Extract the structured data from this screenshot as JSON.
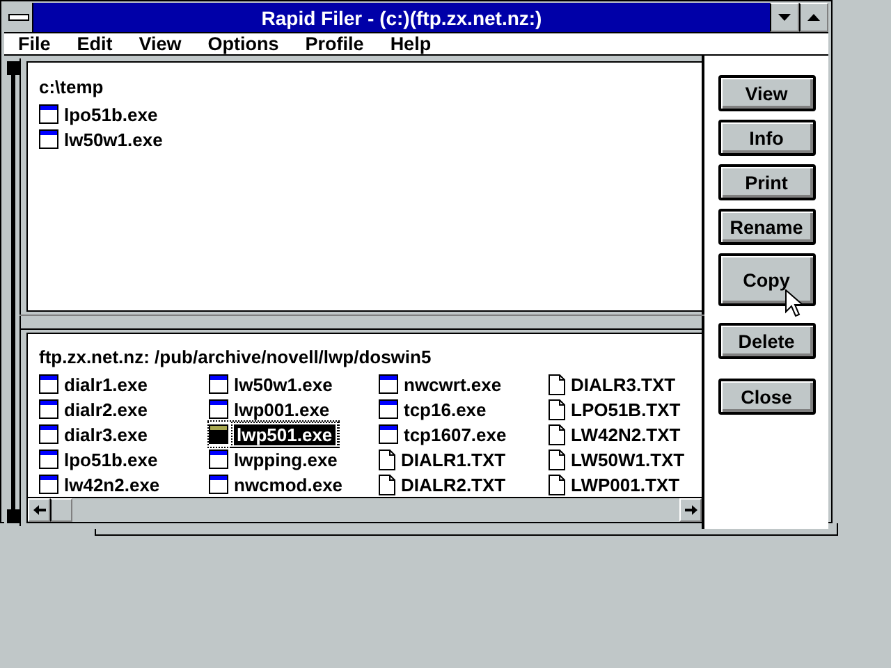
{
  "window": {
    "title": "Rapid Filer - (c:)(ftp.zx.net.nz:)"
  },
  "menu": [
    {
      "label": "File"
    },
    {
      "label": "Edit"
    },
    {
      "label": "View"
    },
    {
      "label": "Options"
    },
    {
      "label": "Profile"
    },
    {
      "label": "Help"
    }
  ],
  "local": {
    "path": "c:\\temp",
    "files": [
      {
        "name": "lpo51b.exe",
        "kind": "program",
        "selected": false
      },
      {
        "name": "lw50w1.exe",
        "kind": "program",
        "selected": false
      }
    ]
  },
  "remote": {
    "path": "ftp.zx.net.nz: /pub/archive/novell/lwp/doswin5",
    "files": [
      {
        "name": "dialr1.exe",
        "kind": "program",
        "selected": false
      },
      {
        "name": "dialr2.exe",
        "kind": "program",
        "selected": false
      },
      {
        "name": "dialr3.exe",
        "kind": "program",
        "selected": false
      },
      {
        "name": "lpo51b.exe",
        "kind": "program",
        "selected": false
      },
      {
        "name": "lw42n2.exe",
        "kind": "program",
        "selected": false
      },
      {
        "name": "lw50w1.exe",
        "kind": "program",
        "selected": false
      },
      {
        "name": "lwp001.exe",
        "kind": "program",
        "selected": false
      },
      {
        "name": "lwp501.exe",
        "kind": "program",
        "selected": true
      },
      {
        "name": "lwpping.exe",
        "kind": "program",
        "selected": false
      },
      {
        "name": "nwcmod.exe",
        "kind": "program",
        "selected": false
      },
      {
        "name": "nwcwrt.exe",
        "kind": "program",
        "selected": false
      },
      {
        "name": "tcp16.exe",
        "kind": "program",
        "selected": false
      },
      {
        "name": "tcp1607.exe",
        "kind": "program",
        "selected": false
      },
      {
        "name": "DIALR1.TXT",
        "kind": "document",
        "selected": false
      },
      {
        "name": "DIALR2.TXT",
        "kind": "document",
        "selected": false
      },
      {
        "name": "DIALR3.TXT",
        "kind": "document",
        "selected": false
      },
      {
        "name": "LPO51B.TXT",
        "kind": "document",
        "selected": false
      },
      {
        "name": "LW42N2.TXT",
        "kind": "document",
        "selected": false
      },
      {
        "name": "LW50W1.TXT",
        "kind": "document",
        "selected": false
      },
      {
        "name": "LWP001.TXT",
        "kind": "document",
        "selected": false
      }
    ]
  },
  "buttons": [
    {
      "label": "View"
    },
    {
      "label": "Info"
    },
    {
      "label": "Print"
    },
    {
      "label": "Rename"
    },
    {
      "label": "Copy"
    },
    {
      "label": "Delete"
    },
    {
      "label": "Close"
    }
  ]
}
